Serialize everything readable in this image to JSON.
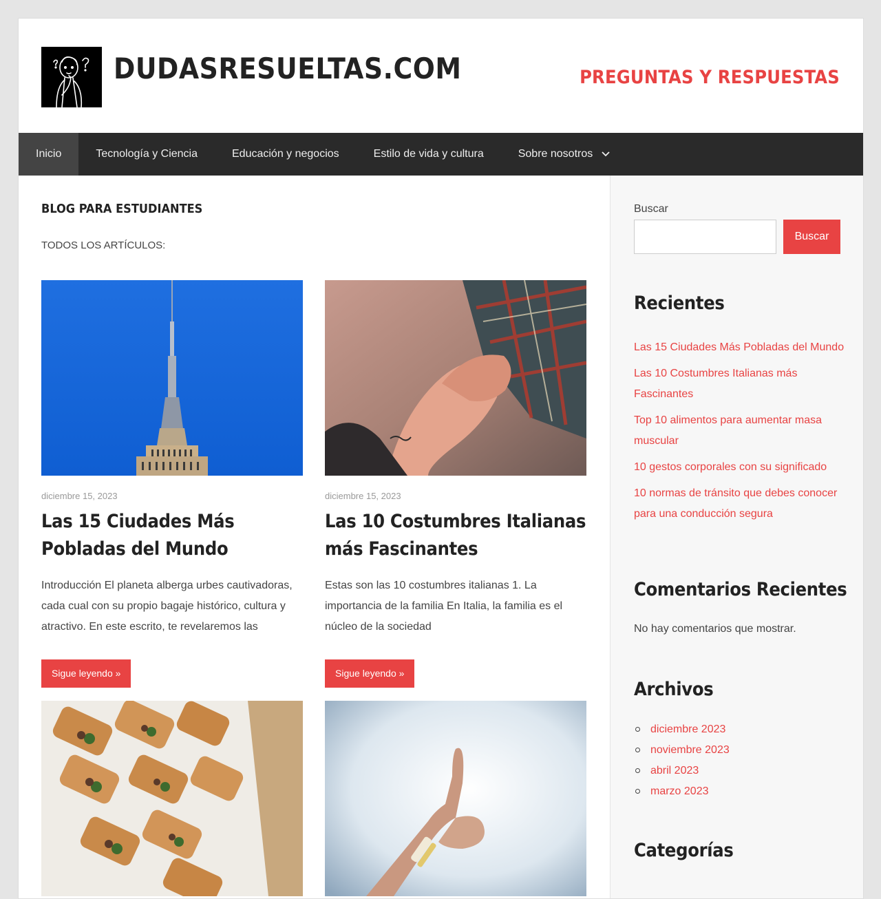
{
  "site": {
    "title": "DUDASRESUELTAS.COM",
    "tagline": "PREGUNTAS Y RESPUESTAS",
    "accent_color": "#e84343"
  },
  "nav": {
    "items": [
      {
        "label": "Inicio",
        "active": true
      },
      {
        "label": "Tecnología y Ciencia"
      },
      {
        "label": "Educación y negocios"
      },
      {
        "label": "Estilo de vida y cultura"
      },
      {
        "label": "Sobre nosotros",
        "has_submenu": true,
        "icon": "chevron-down-icon"
      }
    ]
  },
  "main": {
    "heading": "BLOG PARA ESTUDIANTES",
    "subheading": "TODOS LOS ARTÍCULOS:",
    "posts": [
      {
        "image": "tower-photo",
        "date": "diciembre 15, 2023",
        "title": "Las 15 Ciudades Más Pobladas del Mundo",
        "excerpt": "Introducción El planeta alberga urbes cautivadoras, cada cual con su propio bagaje histórico, cultura y atractivo. En este escrito, te revelaremos las",
        "read_more": "Sigue leyendo »"
      },
      {
        "image": "hands-photo",
        "date": "diciembre 15, 2023",
        "title": "Las 10 Costumbres Italianas más Fascinantes",
        "excerpt": "Estas son las 10 costumbres italianas 1. La importancia de la familia En Italia, la familia es el núcleo de la sociedad",
        "read_more": "Sigue leyendo »"
      },
      {
        "image": "sandwiches-photo"
      },
      {
        "image": "thumbs-up-photo"
      }
    ]
  },
  "sidebar": {
    "search": {
      "label": "Buscar",
      "button": "Buscar",
      "placeholder": ""
    },
    "recent": {
      "title": "Recientes",
      "items": [
        "Las 15 Ciudades Más Pobladas del Mundo",
        "Las 10 Costumbres Italianas más Fascinantes",
        "Top 10 alimentos para aumentar masa muscular",
        "10 gestos corporales con su significado",
        "10 normas de tránsito que debes conocer para una conducción segura"
      ]
    },
    "comments": {
      "title": "Comentarios Recientes",
      "empty": "No hay comentarios que mostrar."
    },
    "archives": {
      "title": "Archivos",
      "items": [
        "diciembre 2023",
        "noviembre 2023",
        "abril 2023",
        "marzo 2023"
      ]
    },
    "categories": {
      "title": "Categorías"
    }
  }
}
